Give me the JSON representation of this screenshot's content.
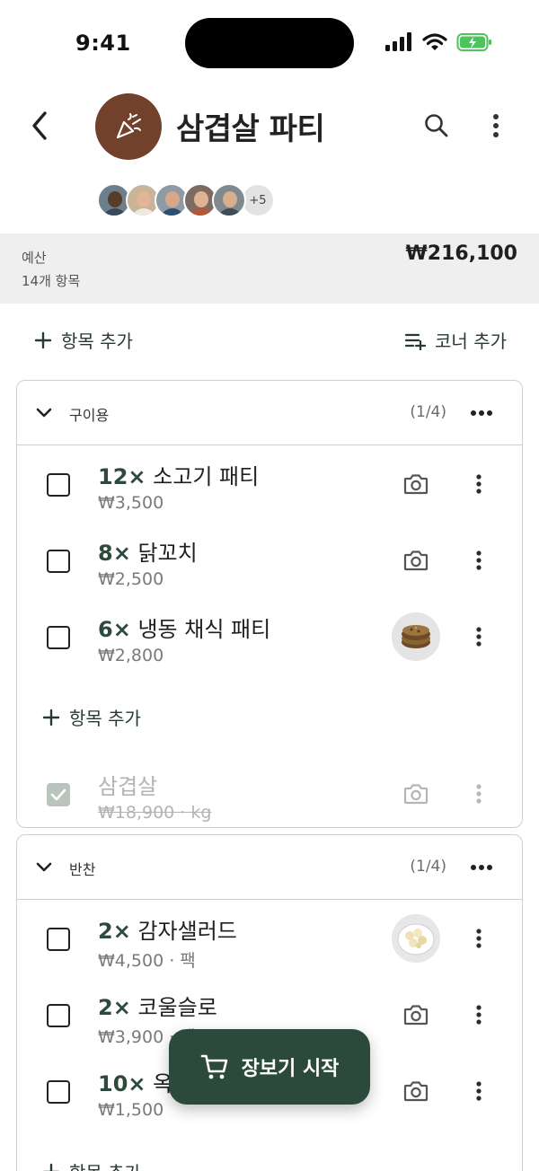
{
  "status_bar": {
    "time": "9:41"
  },
  "header": {
    "title": "삼겹살 파티",
    "member_overflow": "+5"
  },
  "budget": {
    "label": "예산",
    "item_count": "14개 항목",
    "amount": "₩216,100"
  },
  "actions": {
    "add_item": "항목 추가",
    "add_corner": "코너 추가"
  },
  "sections": [
    {
      "name": "구이용",
      "progress": "(1/4)",
      "items": [
        {
          "qty": "12×",
          "name": "소고기 패티",
          "price": "₩3,500",
          "icon": "camera-icon"
        },
        {
          "qty": "8×",
          "name": "닭꼬치",
          "price": "₩2,500",
          "icon": "camera-icon"
        },
        {
          "qty": "6×",
          "name": "냉동 채식 패티",
          "price": "₩2,800",
          "icon": "patty-photo"
        }
      ],
      "add_label": "항목 추가",
      "done_items": [
        {
          "name": "삼겹살",
          "price": "₩18,900 · kg",
          "icon": "camera-icon"
        }
      ]
    },
    {
      "name": "반찬",
      "progress": "(1/4)",
      "items": [
        {
          "qty": "2×",
          "name": "감자샐러드",
          "price": "₩4,500 · 팩",
          "icon": "salad-photo"
        },
        {
          "qty": "2×",
          "name": "코울슬로",
          "price": "₩3,900 · 팩",
          "icon": "camera-icon"
        },
        {
          "qty": "10×",
          "name": "옥수수",
          "price": "₩1,500",
          "icon": "camera-icon"
        }
      ],
      "add_label": "항목 추가"
    }
  ],
  "fab": {
    "label": "장보기 시작"
  },
  "colors": {
    "accent": "#2c4a3c",
    "party_avatar": "#71412c",
    "budget_band": "#efefef"
  }
}
